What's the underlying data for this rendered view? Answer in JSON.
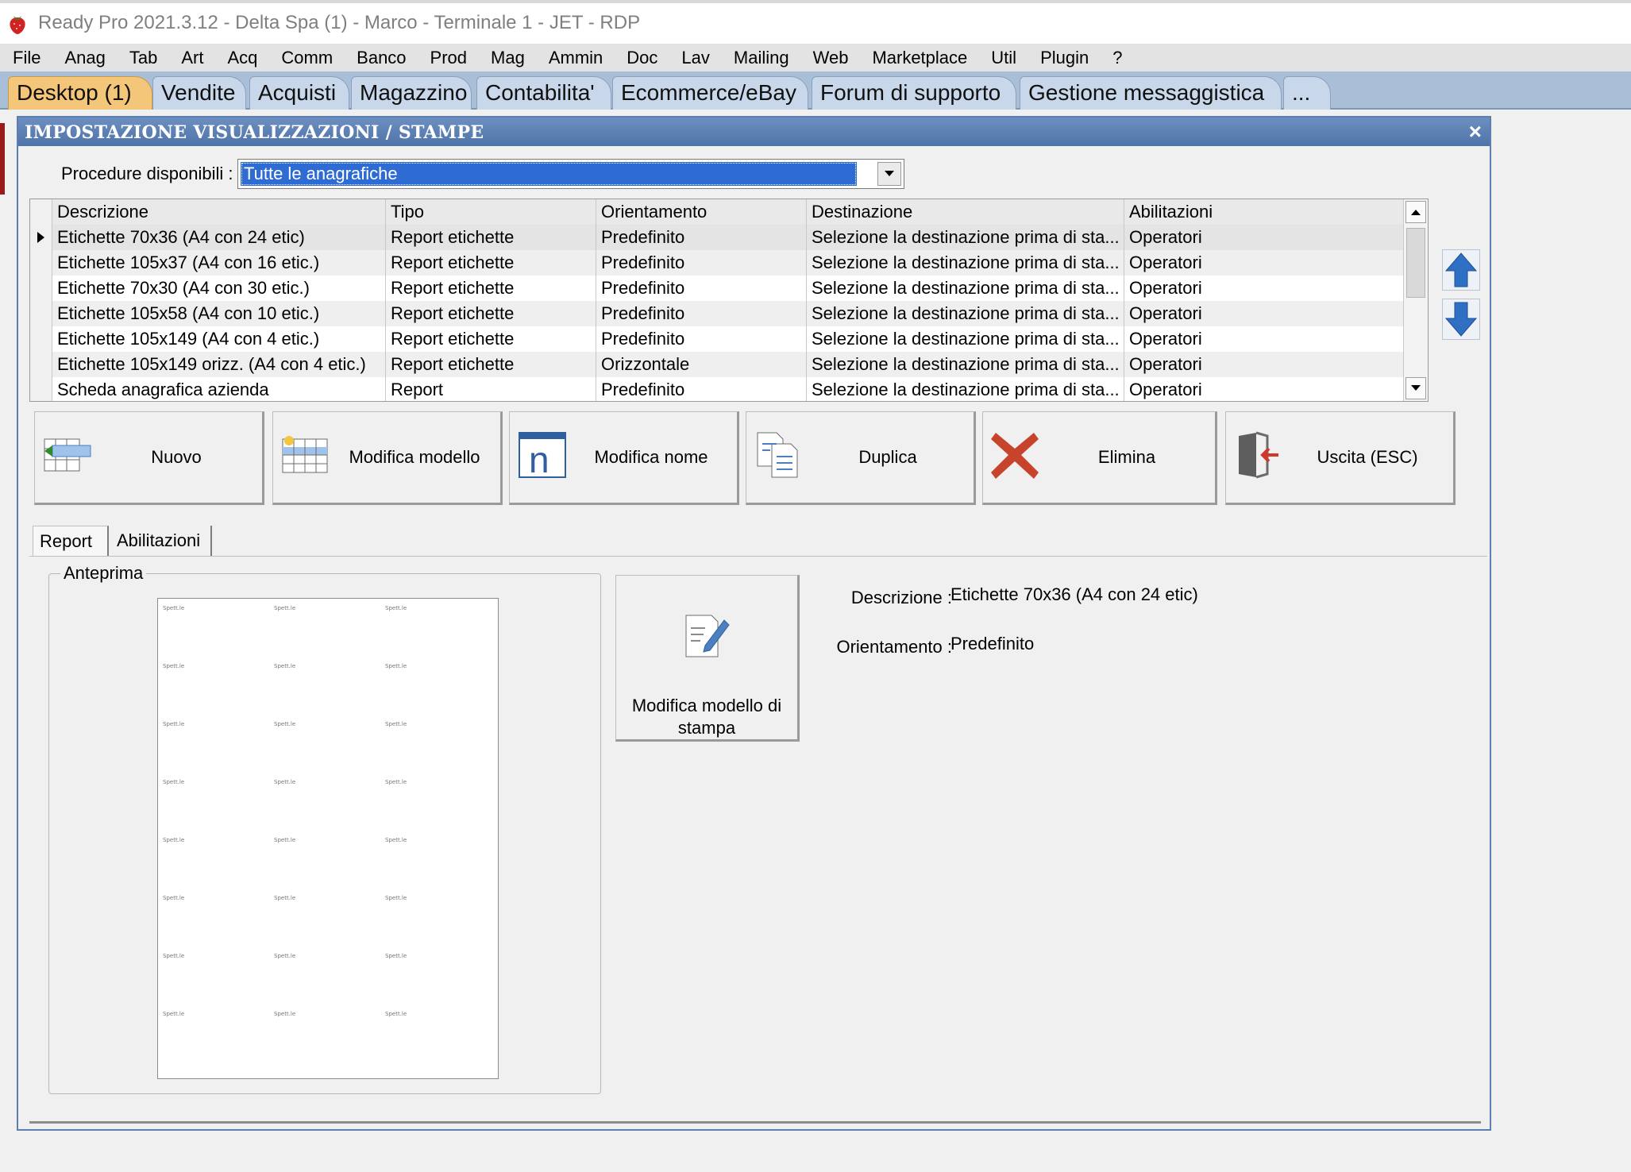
{
  "window": {
    "title": "Ready Pro 2021.3.12 - Delta Spa (1) - Marco - Terminale 1 - JET - RDP"
  },
  "menu": [
    "File",
    "Anag",
    "Tab",
    "Art",
    "Acq",
    "Comm",
    "Banco",
    "Prod",
    "Mag",
    "Ammin",
    "Doc",
    "Lav",
    "Mailing",
    "Web",
    "Marketplace",
    "Util",
    "Plugin",
    "?"
  ],
  "tabs": [
    "Desktop (1)",
    "Vendite",
    "Acquisti",
    "Magazzino",
    "Contabilita'",
    "Ecommerce/eBay",
    "Forum di supporto",
    "Gestione messaggistica",
    "..."
  ],
  "dialog": {
    "title": "IMPOSTAZIONE VISUALIZZAZIONI / STAMPE",
    "close": "×",
    "procedures_label": "Procedure disponibili :",
    "procedures_value": "Tutte le anagrafiche"
  },
  "grid": {
    "columns": [
      "Descrizione",
      "Tipo",
      "Orientamento",
      "Destinazione",
      "Abilitazioni"
    ],
    "rows": [
      [
        "Etichette 70x36 (A4 con 24 etic)",
        "Report etichette",
        "Predefinito",
        "Selezione la destinazione prima di sta...",
        "Operatori"
      ],
      [
        "Etichette 105x37 (A4 con 16 etic.)",
        "Report etichette",
        "Predefinito",
        "Selezione la destinazione prima di sta...",
        "Operatori"
      ],
      [
        "Etichette 70x30 (A4 con 30 etic.)",
        "Report etichette",
        "Predefinito",
        "Selezione la destinazione prima di sta...",
        "Operatori"
      ],
      [
        "Etichette 105x58 (A4 con 10 etic.)",
        "Report etichette",
        "Predefinito",
        "Selezione la destinazione prima di sta...",
        "Operatori"
      ],
      [
        "Etichette 105x149 (A4 con 4 etic.)",
        "Report etichette",
        "Predefinito",
        "Selezione la destinazione prima di sta...",
        "Operatori"
      ],
      [
        "Etichette 105x149 orizz. (A4 con 4 etic.)",
        "Report etichette",
        "Orizzontale",
        "Selezione la destinazione prima di sta...",
        "Operatori"
      ],
      [
        "Scheda anagrafica azienda",
        "Report",
        "Predefinito",
        "Selezione la destinazione prima di sta...",
        "Operatori"
      ]
    ]
  },
  "actions": {
    "nuovo": "Nuovo",
    "modifica_modello": "Modifica modello",
    "modifica_nome": "Modifica nome",
    "duplica": "Duplica",
    "elimina": "Elimina",
    "uscita": "Uscita (ESC)"
  },
  "subtabs": [
    "Report",
    "Abilitazioni"
  ],
  "preview": {
    "legend": "Anteprima",
    "label_text": "Spett.le"
  },
  "edit_button": "Modifica modello di stampa",
  "details": {
    "descrizione_label": "Descrizione :",
    "descrizione_value": "Etichette 70x36 (A4 con 24 etic)",
    "orientamento_label": "Orientamento :",
    "orientamento_value": "Predefinito"
  },
  "colors": {
    "accent_tab": "#f4c67a",
    "dialog_header": "#4f73a9",
    "selection": "#2e6bd3",
    "delete_red": "#c8432c",
    "arrow_blue": "#2f6fc4"
  }
}
